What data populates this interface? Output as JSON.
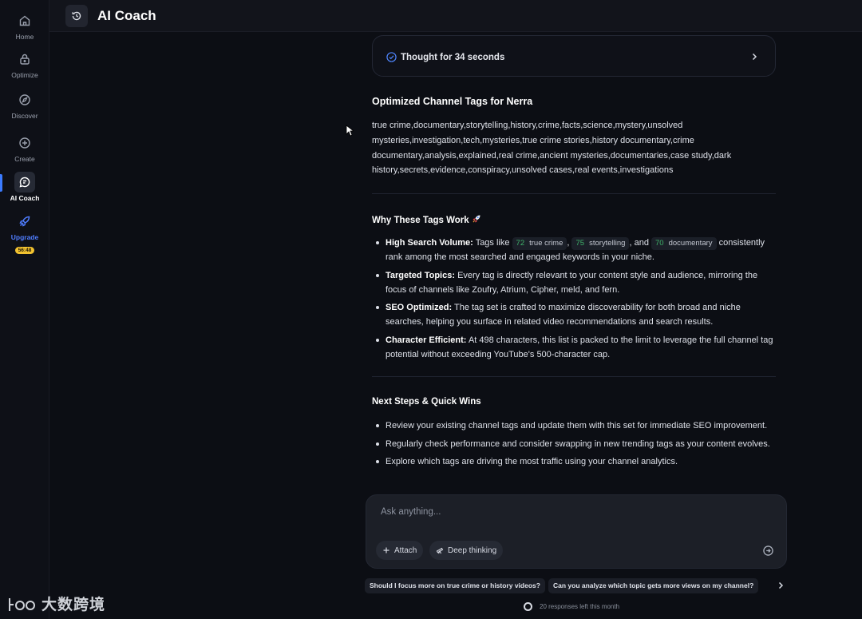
{
  "sidebar": {
    "items": [
      {
        "label": "Home",
        "icon": "home-icon"
      },
      {
        "label": "Optimize",
        "icon": "lock-icon"
      },
      {
        "label": "Discover",
        "icon": "compass-icon"
      },
      {
        "label": "Create",
        "icon": "plus-circle-icon"
      },
      {
        "label": "AI Coach",
        "icon": "chat-icon"
      },
      {
        "label": "Upgrade",
        "icon": "rocket-icon"
      }
    ],
    "upgrade_badge": "56:48"
  },
  "header": {
    "title": "AI Coach"
  },
  "thought": {
    "text": "Thought for 34 seconds"
  },
  "tags_section": {
    "title": "Optimized Channel Tags for Nerra",
    "text": "true crime,documentary,storytelling,history,crime,facts,science,mystery,unsolved mysteries,investigation,tech,mysteries,true crime stories,history documentary,crime documentary,analysis,explained,real crime,ancient mysteries,documentaries,case study,dark history,secrets,evidence,conspiracy,unsolved cases,real events,investigations"
  },
  "why_section": {
    "title": "Why These Tags Work",
    "b1_title": "High Search Volume:",
    "b1_pre": "Tags like",
    "chips": [
      {
        "score": "72",
        "tag": "true crime"
      },
      {
        "score": "75",
        "tag": "storytelling"
      },
      {
        "score": "70",
        "tag": "documentary"
      }
    ],
    "b1_sep": ",",
    "b1_and": ", and",
    "b1_post": "consistently rank among the most searched and engaged keywords in your niche.",
    "b2_title": "Targeted Topics:",
    "b2_text": "Every tag is directly relevant to your content style and audience, mirroring the focus of channels like Zoufry, Atrium, Cipher, meld, and fern.",
    "b3_title": "SEO Optimized:",
    "b3_text": "The tag set is crafted to maximize discoverability for both broad and niche searches, helping you surface in related video recommendations and search results.",
    "b4_title": "Character Efficient:",
    "b4_text": "At 498 characters, this list is packed to the limit to leverage the full channel tag potential without exceeding YouTube's 500-character cap."
  },
  "next_section": {
    "title": "Next Steps & Quick Wins",
    "items": [
      "Review your existing channel tags and update them with this set for immediate SEO improvement.",
      "Regularly check performance and consider swapping in new trending tags as your content evolves.",
      "Explore which tags are driving the most traffic using your channel analytics."
    ]
  },
  "composer": {
    "placeholder": "Ask anything...",
    "attach_label": "Attach",
    "deep_label": "Deep thinking"
  },
  "suggestions": [
    "Should I focus more on true crime or history videos?",
    "Can you analyze which topic gets more views on my channel?"
  ],
  "responses_left": "20 responses left this month",
  "watermark": "大数跨境",
  "colors": {
    "accent": "#3b7bff",
    "score_green": "#3fb26a",
    "badge_yellow": "#f2c230"
  }
}
